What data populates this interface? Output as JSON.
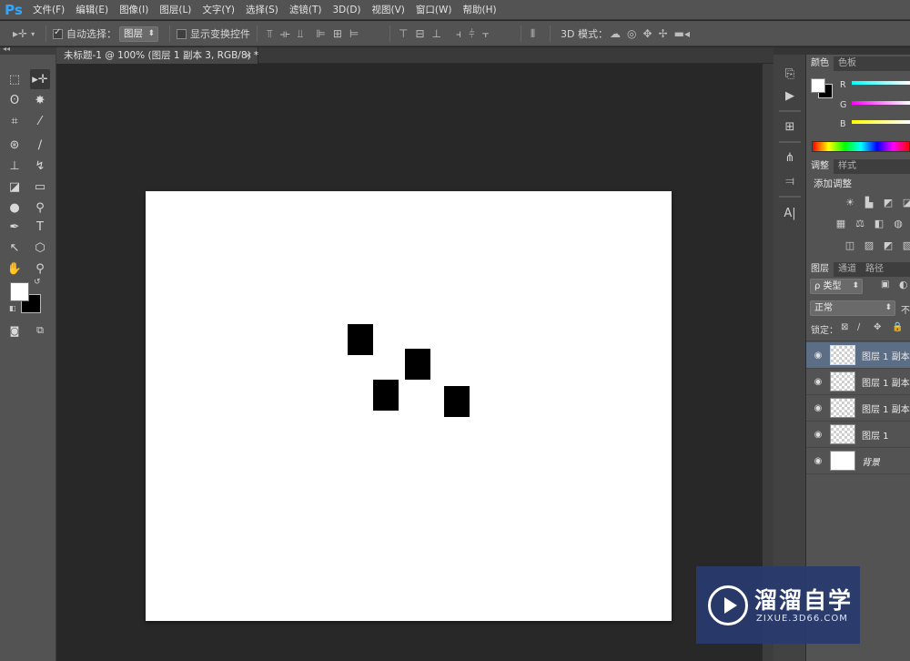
{
  "app": {
    "logo": "Ps"
  },
  "menu": [
    "文件(F)",
    "编辑(E)",
    "图像(I)",
    "图层(L)",
    "文字(Y)",
    "选择(S)",
    "滤镜(T)",
    "3D(D)",
    "视图(V)",
    "窗口(W)",
    "帮助(H)"
  ],
  "options": {
    "auto_select_label": "自动选择：",
    "auto_select_checked": true,
    "auto_select_value": "图层",
    "show_transform_label": "显示变换控件",
    "show_transform_checked": false,
    "mode_3d_label": "3D 模式："
  },
  "document": {
    "tab_title": "未标题-1 @ 100% (图层 1 副本 3, RGB/8) *",
    "close_glyph": "×",
    "background_color": "#ffffff",
    "shapes_color": "#000000"
  },
  "panels": {
    "color": {
      "tabs": [
        "颜色",
        "色板"
      ],
      "channels": [
        "R",
        "G",
        "B"
      ]
    },
    "adjustments": {
      "tabs": [
        "调整",
        "样式"
      ],
      "title": "添加调整"
    },
    "layers": {
      "tabs": [
        "图层",
        "通道",
        "路径"
      ],
      "filter_kind": "ρ 类型",
      "blend_mode": "正常",
      "opacity_label": "不",
      "lock_label": "锁定：",
      "items": [
        {
          "name": "图层 1 副本",
          "selected": true
        },
        {
          "name": "图层 1 副本",
          "selected": false
        },
        {
          "name": "图层 1 副本",
          "selected": false
        },
        {
          "name": "图层 1",
          "selected": false
        },
        {
          "name": "背景",
          "selected": false
        }
      ]
    }
  },
  "watermark": {
    "title": "溜溜自学",
    "subtitle": "ZIXUE.3D66.COM"
  }
}
